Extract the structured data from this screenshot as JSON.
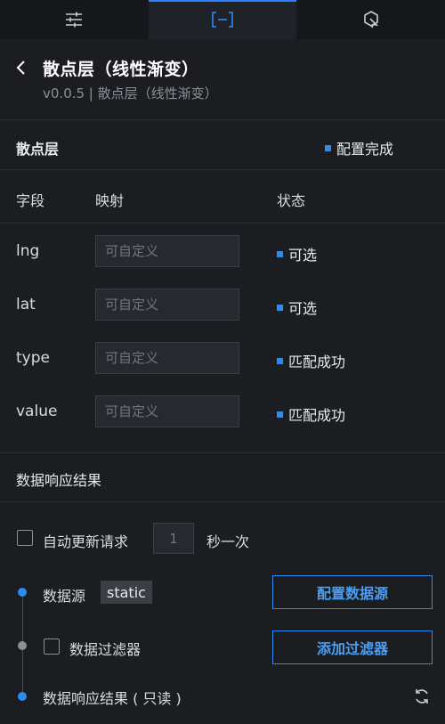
{
  "tabs": [
    {
      "icon": "sliders-icon"
    },
    {
      "icon": "bracket-icon",
      "active": true
    },
    {
      "icon": "interaction-icon"
    }
  ],
  "component": {
    "title": "散点层（线性渐变）",
    "subtitle": "v0.0.5 | 散点层（线性渐变）"
  },
  "layer_section": {
    "title": "散点层",
    "status": "配置完成"
  },
  "table": {
    "headers": {
      "field": "字段",
      "mapping": "映射",
      "status": "状态"
    },
    "rows": [
      {
        "field": "lng",
        "placeholder": "可自定义",
        "status": "可选"
      },
      {
        "field": "lat",
        "placeholder": "可自定义",
        "status": "可选"
      },
      {
        "field": "type",
        "placeholder": "可自定义",
        "status": "匹配成功"
      },
      {
        "field": "value",
        "placeholder": "可自定义",
        "status": "匹配成功"
      }
    ]
  },
  "response_section": {
    "title": "数据响应结果"
  },
  "auto_update": {
    "label": "自动更新请求",
    "interval_placeholder": "1",
    "unit": "秒一次"
  },
  "datasource": {
    "label": "数据源",
    "tag": "static",
    "button": "配置数据源"
  },
  "filter": {
    "label": "数据过滤器",
    "button": "添加过滤器"
  },
  "result": {
    "label": "数据响应结果 ( 只读 )"
  },
  "colors": {
    "accent": "#2d8cf0",
    "background": "#1b1d21",
    "dot_inactive": "#8a8f98"
  }
}
